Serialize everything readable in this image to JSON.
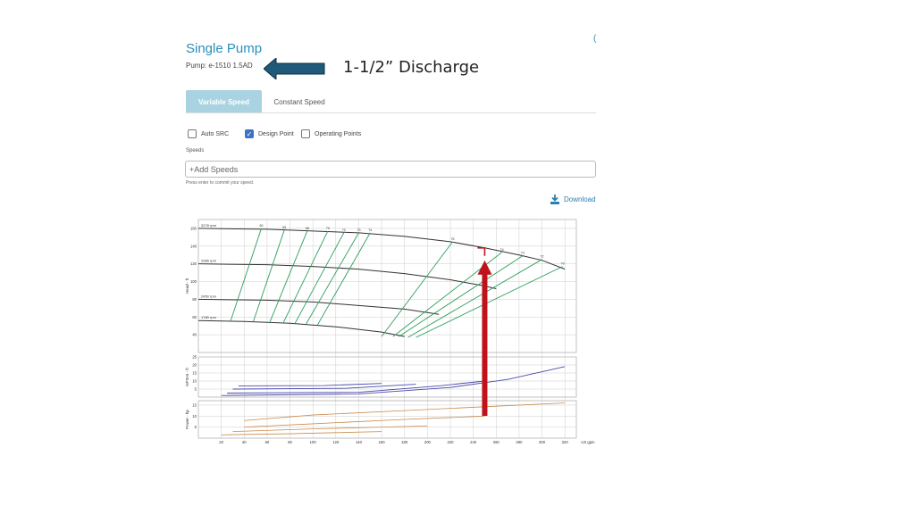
{
  "header": {
    "title": "Single Pump",
    "pump_label": "Pump: e-1510 1.5AD",
    "annotation": "1-1/2” Discharge",
    "corner_glyph": "(",
    "arrow_color": "#1f5a7a"
  },
  "tabs": [
    {
      "label": "Variable Speed",
      "active": true
    },
    {
      "label": "Constant Speed",
      "active": false
    }
  ],
  "options": [
    {
      "label": "Auto SRC",
      "checked": false
    },
    {
      "label": "Design Point",
      "checked": true
    },
    {
      "label": "Operating Points",
      "checked": false
    }
  ],
  "speeds": {
    "label": "Speeds",
    "placeholder": "+Add Speeds",
    "helper": "Press enter to commit your speed."
  },
  "download": {
    "label": "Download",
    "icon": "download-icon"
  },
  "chart_data": {
    "type": "line",
    "x_ticks": [
      "20",
      "40",
      "60",
      "80",
      "100",
      "120",
      "140",
      "160",
      "180",
      "200",
      "220",
      "240",
      "260",
      "280",
      "300",
      "320"
    ],
    "x_unit": "US gpm",
    "xlim": [
      0,
      330
    ],
    "head": {
      "ylabel": "Head - ft",
      "y_ticks": [
        "40",
        "60",
        "80",
        "100",
        "120",
        "140",
        "160"
      ],
      "ylim": [
        20,
        170
      ],
      "speed_curves": [
        {
          "name": "3278 rpm",
          "x": [
            0,
            60,
            100,
            140,
            180,
            220,
            250,
            280,
            300,
            320
          ],
          "y": [
            160,
            159,
            157,
            155,
            151,
            145,
            138,
            130,
            124,
            114
          ]
        },
        {
          "name": "2985 rpm",
          "x": [
            0,
            60,
            100,
            140,
            180,
            220,
            250,
            260
          ],
          "y": [
            120,
            119,
            117,
            114,
            109,
            102,
            95,
            92
          ]
        },
        {
          "name": "2450 rpm",
          "x": [
            0,
            60,
            100,
            140,
            180,
            200,
            210
          ],
          "y": [
            80,
            79,
            77,
            73,
            69,
            65,
            63
          ]
        },
        {
          "name": "1780 rpm",
          "x": [
            0,
            40,
            80,
            120,
            160,
            180
          ],
          "y": [
            56,
            55,
            53,
            49,
            43,
            38
          ]
        }
      ],
      "efficiency_labels": [
        "60",
        "65",
        "68",
        "70",
        "72",
        "73",
        "74",
        "75",
        "74",
        "73",
        "72",
        "70"
      ],
      "efficiency_lines": [
        {
          "x": [
            28,
            55
          ],
          "y": [
            55,
            160
          ]
        },
        {
          "x": [
            48,
            75
          ],
          "y": [
            55,
            158
          ]
        },
        {
          "x": [
            62,
            95
          ],
          "y": [
            53,
            157
          ]
        },
        {
          "x": [
            74,
            113
          ],
          "y": [
            53,
            157
          ]
        },
        {
          "x": [
            84,
            127
          ],
          "y": [
            52,
            155
          ]
        },
        {
          "x": [
            94,
            140
          ],
          "y": [
            52,
            155
          ]
        },
        {
          "x": [
            104,
            150
          ],
          "y": [
            51,
            155
          ]
        },
        {
          "x": [
            160,
            222
          ],
          "y": [
            38,
            145
          ]
        },
        {
          "x": [
            170,
            265
          ],
          "y": [
            38,
            133
          ]
        },
        {
          "x": [
            175,
            283
          ],
          "y": [
            38,
            129
          ]
        },
        {
          "x": [
            183,
            300
          ],
          "y": [
            37,
            125
          ]
        },
        {
          "x": [
            190,
            318
          ],
          "y": [
            37,
            117
          ]
        }
      ],
      "design_point": {
        "x": 250,
        "y": 138
      }
    },
    "npshr": {
      "ylabel": "NPSHr - ft",
      "y_ticks": [
        "5",
        "10",
        "15",
        "20",
        "25"
      ],
      "ylim": [
        0,
        25
      ],
      "curves": [
        {
          "x": [
            20,
            140,
            220,
            270,
            320
          ],
          "y": [
            1,
            2,
            6,
            11,
            19
          ]
        },
        {
          "x": [
            25,
            140,
            210,
            250
          ],
          "y": [
            2.5,
            3,
            7,
            10
          ]
        },
        {
          "x": [
            30,
            130,
            190
          ],
          "y": [
            5,
            5.5,
            8
          ]
        },
        {
          "x": [
            35,
            110,
            160
          ],
          "y": [
            7,
            7.2,
            8.5
          ]
        }
      ]
    },
    "power": {
      "ylabel": "Power - hp",
      "y_ticks": [
        "5",
        "10",
        "15"
      ],
      "ylim": [
        0,
        17
      ],
      "curves": [
        {
          "x": [
            40,
            100,
            180,
            260,
            320
          ],
          "y": [
            8,
            10.5,
            12.5,
            14.5,
            16
          ]
        },
        {
          "x": [
            40,
            100,
            180,
            250
          ],
          "y": [
            5,
            6.5,
            8.5,
            10
          ]
        },
        {
          "x": [
            30,
            100,
            160,
            200
          ],
          "y": [
            3,
            4.2,
            5,
            5.5
          ]
        },
        {
          "x": [
            20,
            80,
            120,
            160
          ],
          "y": [
            1.5,
            2,
            2.5,
            3
          ]
        }
      ]
    },
    "colors": {
      "head": "#333333",
      "efficiency": "#2e9e5b",
      "npshr": "#4a4aaa",
      "power": "#c98a4b",
      "marker": "#c0121a"
    }
  }
}
